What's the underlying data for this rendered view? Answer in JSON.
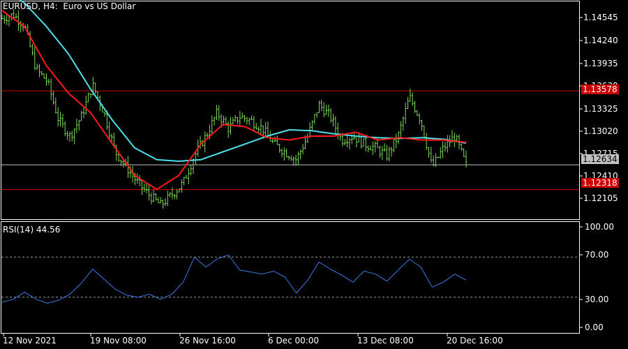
{
  "header": {
    "symbol": "EURUSD",
    "timeframe": "H4",
    "description": "Euro vs US Dollar"
  },
  "rsi_header": {
    "label": "RSI(14)",
    "value": "44.56"
  },
  "x_ticks": [
    "12 Nov 2021",
    "19 Nov 08:00",
    "26 Nov 16:00",
    "6 Dec 00:00",
    "13 Dec 08:00",
    "20 Dec 16:00"
  ],
  "price_ticks": [
    "1.14545",
    "1.14240",
    "1.13935",
    "1.13630",
    "1.13325",
    "1.13020",
    "1.12715",
    "1.12410",
    "1.12105"
  ],
  "rsi_ticks": [
    "100.00",
    "70.00",
    "30.00",
    "0.00"
  ],
  "markers": {
    "resistance": {
      "label": "1.13578",
      "value": 1.13578,
      "color": "#cc0000"
    },
    "current": {
      "label": "1.12634",
      "value": 1.12634,
      "color": "#c0c0c0"
    },
    "support": {
      "label": "1.12318",
      "value": 1.12318,
      "color": "#cc0000"
    }
  },
  "colors": {
    "background": "#000000",
    "grid": "#ffffff",
    "candle": "#7ed957",
    "ma_fast": "#ff1a1a",
    "ma_slow": "#4de0e8",
    "rsi_line": "#3a78e0"
  },
  "chart_data": [
    {
      "type": "line",
      "title": "EURUSD, H4: Euro vs US Dollar",
      "y_range": [
        1.1195,
        1.147
      ],
      "series": [
        {
          "name": "close",
          "x": [
            "11/11",
            "11/12",
            "11/13",
            "11/14",
            "11/15",
            "11/16",
            "11/17",
            "11/18",
            "11/19",
            "11/20",
            "11/21",
            "11/22",
            "11/23",
            "11/24",
            "11/25",
            "11/26",
            "11/27",
            "11/28",
            "11/29",
            "11/30",
            "12/1",
            "12/2",
            "12/3",
            "12/4",
            "12/5",
            "12/6",
            "12/7",
            "12/8",
            "12/9",
            "12/10",
            "12/11",
            "12/12",
            "12/13",
            "12/14",
            "12/15",
            "12/16",
            "12/17",
            "12/18",
            "12/19",
            "12/20",
            "12/21",
            "12/22"
          ],
          "values": [
            1.145,
            1.1455,
            1.144,
            1.1385,
            1.137,
            1.132,
            1.13,
            1.1325,
            1.1365,
            1.133,
            1.128,
            1.126,
            1.124,
            1.1225,
            1.1212,
            1.1225,
            1.124,
            1.1275,
            1.13,
            1.133,
            1.131,
            1.1325,
            1.132,
            1.131,
            1.129,
            1.128,
            1.127,
            1.13,
            1.134,
            1.1325,
            1.1295,
            1.13,
            1.129,
            1.1285,
            1.1275,
            1.13,
            1.135,
            1.132,
            1.126,
            1.1285,
            1.13,
            1.1263
          ]
        },
        {
          "name": "moving average (red)",
          "x": [
            "11/11",
            "11/13",
            "11/15",
            "11/17",
            "11/19",
            "11/21",
            "11/23",
            "11/25",
            "11/27",
            "11/29",
            "12/1",
            "12/3",
            "12/5",
            "12/7",
            "12/9",
            "12/11",
            "12/13",
            "12/15",
            "12/17",
            "12/19",
            "12/21",
            "12/22"
          ],
          "values": [
            1.146,
            1.144,
            1.139,
            1.1355,
            1.133,
            1.129,
            1.125,
            1.1232,
            1.125,
            1.129,
            1.1315,
            1.1312,
            1.1298,
            1.1295,
            1.13,
            1.13,
            1.1305,
            1.1295,
            1.1298,
            1.1295,
            1.1295,
            1.1292
          ]
        },
        {
          "name": "moving average (cyan)",
          "x": [
            "11/11",
            "11/13",
            "11/15",
            "11/17",
            "11/19",
            "11/21",
            "11/23",
            "11/25",
            "11/27",
            "11/29",
            "12/1",
            "12/3",
            "12/5",
            "12/7",
            "12/9",
            "12/11",
            "12/13",
            "12/15",
            "12/17",
            "12/19",
            "12/21",
            "12/22"
          ],
          "values": [
            1.149,
            1.147,
            1.144,
            1.1405,
            1.136,
            1.132,
            1.1285,
            1.127,
            1.1268,
            1.127,
            1.128,
            1.129,
            1.13,
            1.1308,
            1.1307,
            1.1303,
            1.13,
            1.1298,
            1.1297,
            1.1298,
            1.1296,
            1.1291
          ]
        }
      ]
    },
    {
      "type": "line",
      "title": "RSI(14) 44.56",
      "y_range": [
        0,
        100
      ],
      "levels": [
        70,
        30
      ],
      "series": [
        {
          "name": "RSI(14)",
          "x": [
            "11/11",
            "11/12",
            "11/13",
            "11/14",
            "11/15",
            "11/16",
            "11/17",
            "11/18",
            "11/19",
            "11/20",
            "11/21",
            "11/22",
            "11/23",
            "11/24",
            "11/25",
            "11/26",
            "11/27",
            "11/28",
            "11/29",
            "11/30",
            "12/1",
            "12/2",
            "12/3",
            "12/4",
            "12/5",
            "12/6",
            "12/7",
            "12/8",
            "12/9",
            "12/10",
            "12/11",
            "12/12",
            "12/13",
            "12/14",
            "12/15",
            "12/16",
            "12/17",
            "12/18",
            "12/19",
            "12/20",
            "12/21",
            "12/22"
          ],
          "values": [
            25,
            28,
            35,
            28,
            24,
            27,
            33,
            44,
            58,
            48,
            38,
            32,
            30,
            33,
            28,
            33,
            45,
            70,
            60,
            68,
            72,
            57,
            55,
            53,
            56,
            50,
            34,
            47,
            65,
            58,
            52,
            45,
            56,
            53,
            46,
            57,
            68,
            60,
            40,
            45,
            53,
            47
          ]
        }
      ]
    }
  ]
}
